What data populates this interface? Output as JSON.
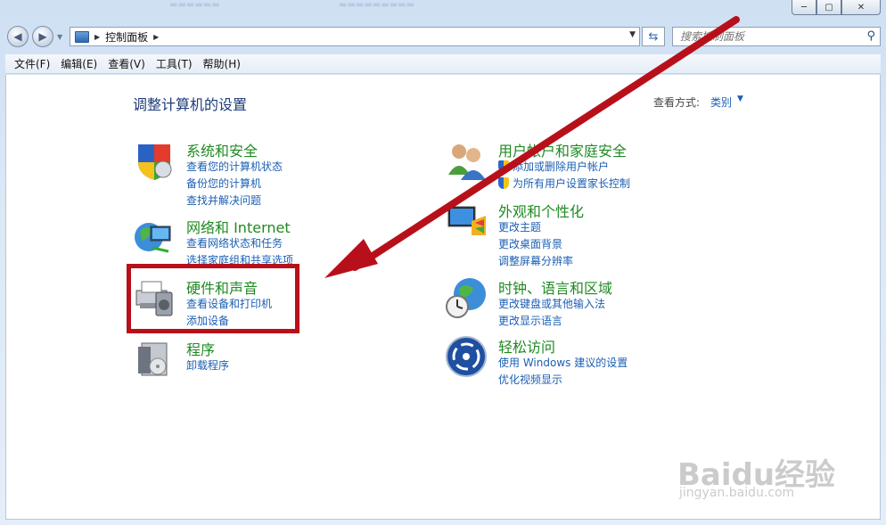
{
  "window": {
    "caption": {
      "minimize": "─",
      "maximize": "▢",
      "close": "✕"
    }
  },
  "address_bar": {
    "crumb": "控制面板",
    "search_placeholder": "搜索控制面板"
  },
  "menu": [
    "文件(F)",
    "编辑(E)",
    "查看(V)",
    "工具(T)",
    "帮助(H)"
  ],
  "content": {
    "title": "调整计算机的设置",
    "view_by_label": "查看方式:",
    "view_by_value": "类别"
  },
  "categories": {
    "system_security": {
      "title": "系统和安全",
      "links": [
        "查看您的计算机状态",
        "备份您的计算机",
        "查找并解决问题"
      ]
    },
    "network": {
      "title": "网络和 Internet",
      "links": [
        "查看网络状态和任务",
        "选择家庭组和共享选项"
      ]
    },
    "hardware": {
      "title": "硬件和声音",
      "links": [
        "查看设备和打印机",
        "添加设备"
      ]
    },
    "programs": {
      "title": "程序",
      "links": [
        "卸载程序"
      ]
    },
    "user_accounts": {
      "title": "用户帐户和家庭安全",
      "links": [
        "添加或删除用户帐户",
        "为所有用户设置家长控制"
      ]
    },
    "appearance": {
      "title": "外观和个性化",
      "links": [
        "更改主题",
        "更改桌面背景",
        "调整屏幕分辨率"
      ]
    },
    "clock": {
      "title": "时钟、语言和区域",
      "links": [
        "更改键盘或其他输入法",
        "更改显示语言"
      ]
    },
    "ease": {
      "title": "轻松访问",
      "links": [
        "使用 Windows 建议的设置",
        "优化视频显示"
      ]
    }
  },
  "watermark": {
    "brand": "Baidu经验",
    "url": "jingyan.baidu.com"
  },
  "colors": {
    "highlight": "#b8101a",
    "arrow": "#b8101a",
    "category_title": "#1f8a22",
    "link": "#1b5fb4"
  }
}
